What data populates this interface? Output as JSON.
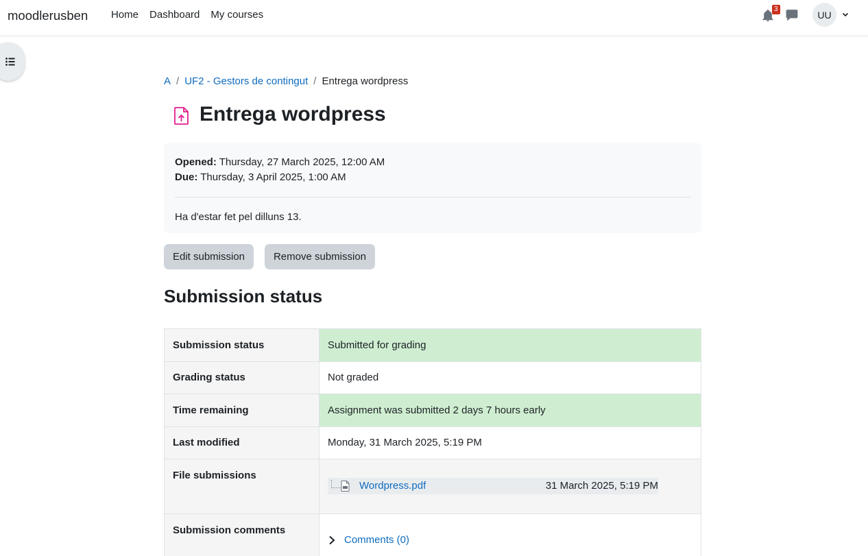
{
  "navbar": {
    "brand": "moodlerusben",
    "links": [
      "Home",
      "Dashboard",
      "My courses"
    ],
    "notification_count": "3",
    "avatar_initials": "UU"
  },
  "breadcrumb": [
    "A",
    "UF2 - Gestors de contingut",
    "Entrega wordpress"
  ],
  "page": {
    "title": "Entrega wordpress",
    "opened_label": "Opened:",
    "opened_value": "Thursday, 27 March 2025, 12:00 AM",
    "due_label": "Due:",
    "due_value": "Thursday, 3 April 2025, 1:00 AM",
    "description": "Ha d'estar fet pel dilluns 13."
  },
  "buttons": {
    "edit": "Edit submission",
    "remove": "Remove submission"
  },
  "section_title": "Submission status",
  "status_rows": [
    {
      "label": "Submission status",
      "value": "Submitted for grading"
    },
    {
      "label": "Grading status",
      "value": "Not graded"
    },
    {
      "label": "Time remaining",
      "value": "Assignment was submitted 2 days 7 hours early"
    },
    {
      "label": "Last modified",
      "value": "Monday, 31 March 2025, 5:19 PM"
    },
    {
      "label": "File submissions",
      "file_name": "Wordpress.pdf",
      "file_date": "31 March 2025, 5:19 PM"
    },
    {
      "label": "Submission comments",
      "value": "Comments (0)"
    }
  ],
  "colors": {
    "accent": "#0f6cbf",
    "success_bg": "#cfeed1",
    "icon_pink": "#e31c8e",
    "badge_red": "#ca3120"
  },
  "icons": [
    "bell-icon",
    "chat-icon",
    "chevron-down-icon",
    "list-icon",
    "assignment-upload-icon",
    "pdf-file-icon",
    "chevron-right-icon"
  ]
}
